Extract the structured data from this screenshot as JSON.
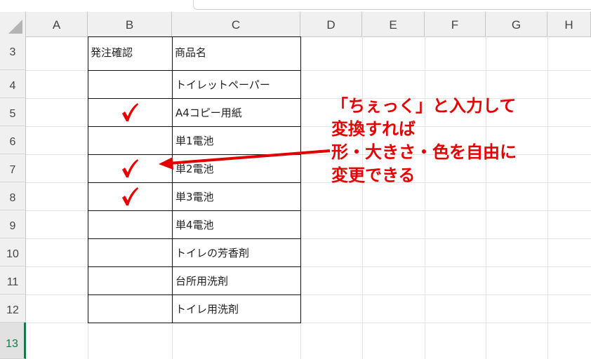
{
  "columns": [
    "A",
    "B",
    "C",
    "D",
    "E",
    "F",
    "G",
    "H"
  ],
  "rows": [
    "3",
    "4",
    "5",
    "6",
    "7",
    "8",
    "9",
    "10",
    "11",
    "12",
    "13"
  ],
  "table": {
    "header_b": "発注確認",
    "header_c": "商品名",
    "items": [
      {
        "name": "トイレットペーパー",
        "checked": false
      },
      {
        "name": "A4コピー用紙",
        "checked": true
      },
      {
        "name": "単1電池",
        "checked": false
      },
      {
        "name": "単2電池",
        "checked": true
      },
      {
        "name": "単3電池",
        "checked": true
      },
      {
        "name": "単4電池",
        "checked": false
      },
      {
        "name": "トイレの芳香剤",
        "checked": false
      },
      {
        "name": "台所用洗剤",
        "checked": false
      },
      {
        "name": "トイレ用洗剤",
        "checked": false
      }
    ]
  },
  "annotation": {
    "lines": [
      "「ちぇっく」と入力して",
      "変換すれば",
      "形・大きさ・色を自由に",
      "変更できる"
    ],
    "color": "#e60000"
  },
  "check_color": "#e60000",
  "active_row_color": "#107c41"
}
